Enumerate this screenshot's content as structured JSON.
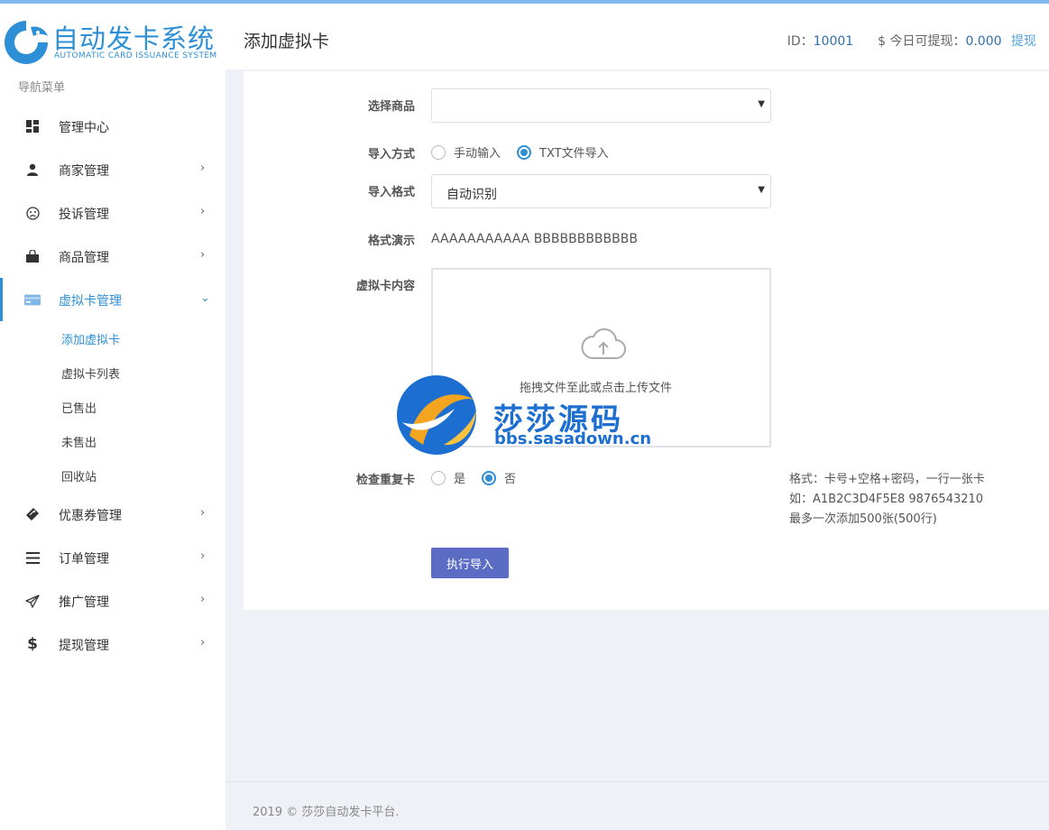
{
  "brand": {
    "title": "自动发卡系统",
    "subtitle": "AUTOMATIC CARD ISSUANCE SYSTEM",
    "color": "#2d8fd5"
  },
  "sidebar": {
    "caption": "导航菜单",
    "items": [
      {
        "label": "管理中心",
        "icon": "dashboard-icon"
      },
      {
        "label": "商家管理",
        "icon": "user-icon"
      },
      {
        "label": "投诉管理",
        "icon": "sad-face-icon"
      },
      {
        "label": "商品管理",
        "icon": "shopping-bag-icon"
      },
      {
        "label": "虚拟卡管理",
        "icon": "card-icon"
      },
      {
        "label": "优惠券管理",
        "icon": "ticket-icon"
      },
      {
        "label": "订单管理",
        "icon": "list-icon"
      },
      {
        "label": "推广管理",
        "icon": "paper-plane-icon"
      },
      {
        "label": "提现管理",
        "icon": "dollar-icon"
      }
    ],
    "submenu": [
      "添加虚拟卡",
      "虚拟卡列表",
      "已售出",
      "未售出",
      "回收站"
    ]
  },
  "header": {
    "page_title": "添加虚拟卡",
    "id_label": "ID：",
    "id_value": "10001",
    "withdraw_label": "$ 今日可提现：",
    "withdraw_value": "0.000",
    "withdraw_link": "提现"
  },
  "form": {
    "product_label": "选择商品",
    "product_value": "",
    "import_method_label": "导入方式",
    "import_methods": [
      "手动输入",
      "TXT文件导入"
    ],
    "import_method_selected": "TXT文件导入",
    "import_format_label": "导入格式",
    "import_format_value": "自动识别",
    "demo_label": "格式演示",
    "demo_value": "AAAAAAAAAAA BBBBBBBBBBBB",
    "content_label": "虚拟卡内容",
    "upload_hint": "拖拽文件至此或点击上传文件",
    "dup_label": "检查重复卡",
    "dup_options": [
      "是",
      "否"
    ],
    "dup_selected": "否",
    "notes": [
      "格式：卡号+空格+密码，一行一张卡",
      "如：A1B2C3D4F5E8 9876543210",
      "最多一次添加500张(500行)"
    ],
    "submit_label": "执行导入"
  },
  "watermark": {
    "text": "莎莎源码",
    "url": "bbs.sasadown.cn"
  },
  "footer": {
    "text": "2019 © 莎莎自动发卡平台."
  },
  "colors": {
    "accent": "#2d8fd5",
    "button": "#5b6cc4",
    "background": "#eef1f5"
  }
}
